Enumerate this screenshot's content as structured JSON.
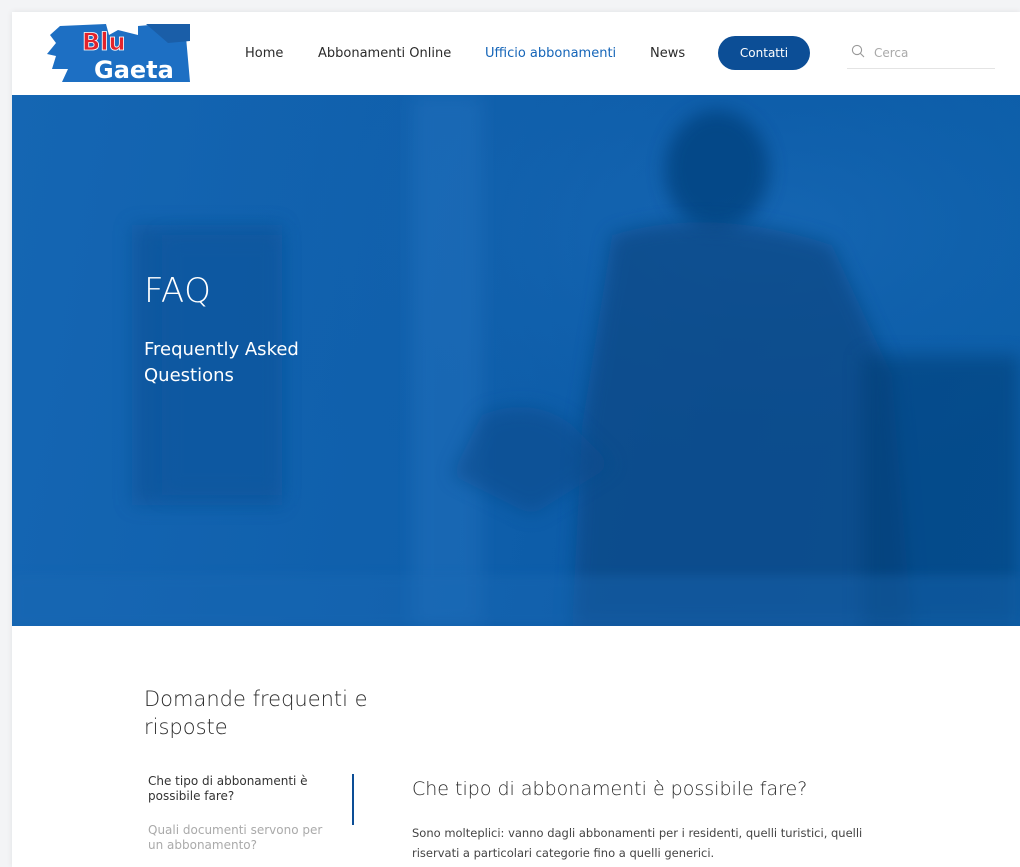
{
  "header": {
    "logo": {
      "line1": "Blu",
      "line2": "Gaeta"
    },
    "nav": [
      {
        "label": "Home",
        "active": false
      },
      {
        "label": "Abbonamenti Online",
        "active": false
      },
      {
        "label": "Ufficio abbonamenti",
        "active": true
      },
      {
        "label": "News",
        "active": false
      }
    ],
    "contact_label": "Contatti",
    "search": {
      "placeholder": "Cerca",
      "value": ""
    }
  },
  "hero": {
    "title": "FAQ",
    "subtitle": "Frequently Asked Questions"
  },
  "faq": {
    "section_title": "Domande frequenti e risposte",
    "questions": [
      {
        "label": "Che tipo di abbonamenti è possibile fare?",
        "active": true
      },
      {
        "label": "Quali documenti servono per un abbonamento?",
        "active": false
      }
    ],
    "answer": {
      "title": "Che tipo di abbonamenti è possibile fare?",
      "body": "Sono molteplici: vanno dagli abbonamenti per i residenti, quelli turistici, quelli riservati a particolari categorie fino a quelli generici."
    }
  },
  "colors": {
    "brand_blue": "#0c4e96",
    "active_nav": "#1565b8",
    "hero_blue": "#0f5fab",
    "logo_red": "#e3232b"
  }
}
